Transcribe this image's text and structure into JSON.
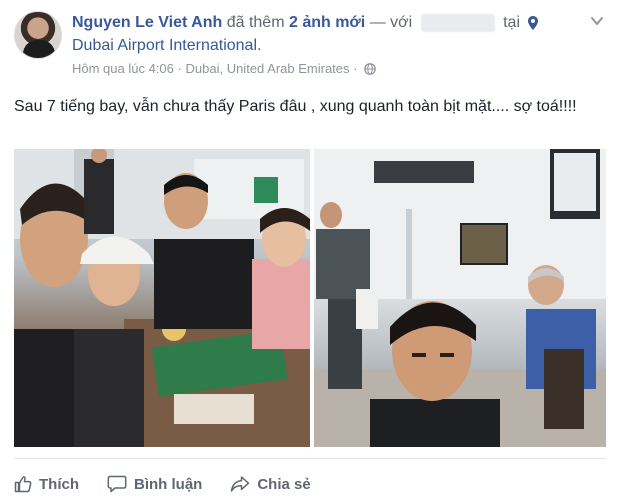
{
  "post": {
    "author": "Nguyen Le Viet Anh",
    "action_text": "đã thêm",
    "photos_link": "2 ảnh mới",
    "with_text": "— với",
    "at_text": "tại",
    "place": "Dubai Airport International.",
    "time": "Hôm qua lúc 4:06",
    "separator1": "·",
    "location": "Dubai, United Arab Emirates",
    "separator2": "·",
    "privacy_icon": "globe-icon",
    "body": "Sau 7 tiếng bay, vẫn chưa thấy Paris đâu , xung quanh toàn bịt mặt.... sợ toá!!!!"
  },
  "actions": {
    "like": "Thích",
    "comment": "Bình luận",
    "share": "Chia sẻ"
  },
  "icons": {
    "location": "location-pin-icon",
    "menu": "chevron-down-icon",
    "like": "thumbs-up-icon",
    "comment": "comment-bubble-icon",
    "share": "share-arrow-icon"
  },
  "colors": {
    "link": "#385898",
    "meta": "#90949c",
    "action": "#606770"
  }
}
